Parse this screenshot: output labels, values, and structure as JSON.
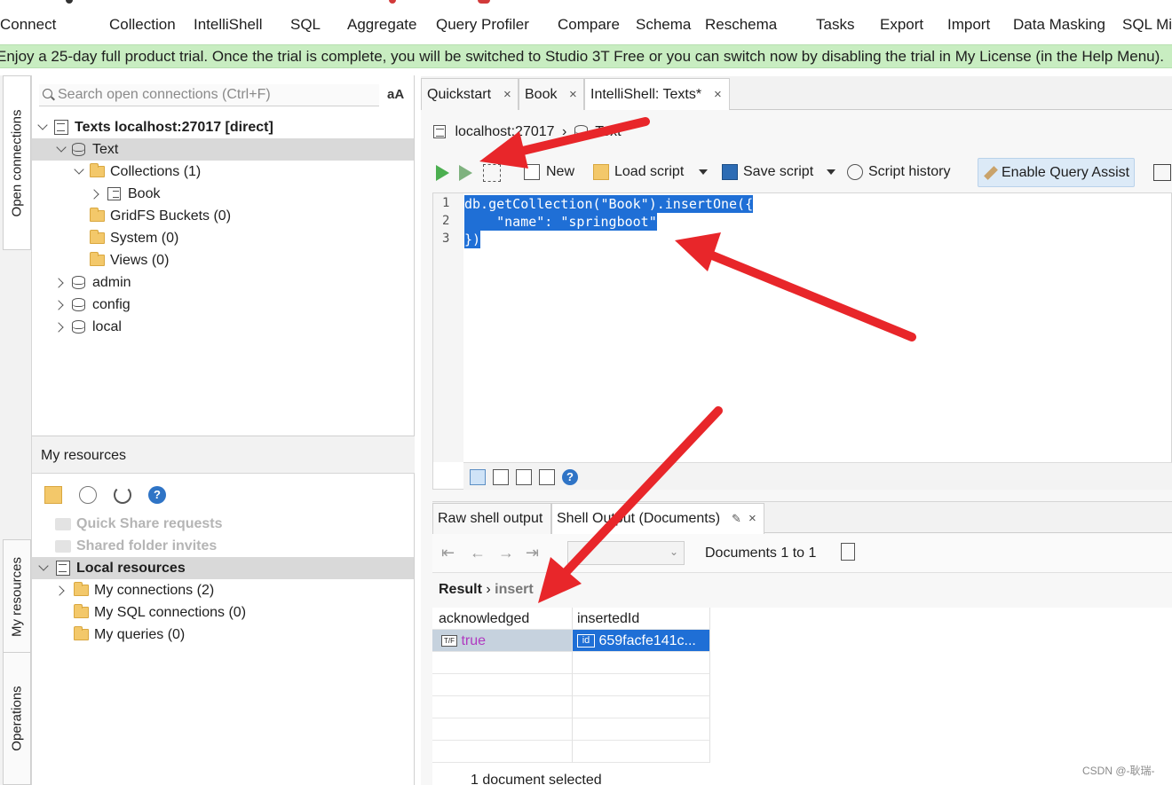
{
  "toolbar": {
    "items": [
      "Connect",
      "Collection",
      "IntelliShell",
      "SQL",
      "Aggregate",
      "Query Profiler",
      "Compare",
      "Schema",
      "Reschema",
      "Tasks",
      "Export",
      "Import",
      "Data Masking",
      "SQL Mig"
    ]
  },
  "banner": {
    "text": "Enjoy a 25-day full product trial. Once the trial is complete, you will be switched to Studio 3T Free or you can switch now by disabling the trial in My License (in the Help Menu)."
  },
  "side_tabs": [
    "Open connections",
    "My resources",
    "Operations"
  ],
  "connections": {
    "search_placeholder": "Search open connections (Ctrl+F)",
    "font_toggle": "aA",
    "tree": {
      "server": "Texts localhost:27017 [direct]",
      "db_selected": "Text",
      "collections": "Collections (1)",
      "collection_book": "Book",
      "gridfs": "GridFS Buckets (0)",
      "system": "System (0)",
      "views": "Views (0)",
      "db_admin": "admin",
      "db_config": "config",
      "db_local": "local"
    }
  },
  "my_resources": {
    "title": "My resources",
    "quick_share": "Quick Share requests",
    "shared_invites": "Shared folder invites",
    "local_resources": "Local resources",
    "my_connections": "My connections (2)",
    "my_sql_connections": "My SQL connections (0)",
    "my_queries": "My queries (0)"
  },
  "editor": {
    "tabs": [
      {
        "label": "Quickstart",
        "close": "×"
      },
      {
        "label": "Book",
        "close": "×"
      },
      {
        "label": "IntelliShell: Texts*",
        "close": "×"
      }
    ],
    "breadcrumb_host": "localhost:27017",
    "breadcrumb_db": "Text",
    "toolbar": {
      "new": "New",
      "load_script": "Load script",
      "save_script": "Save script",
      "script_history": "Script history",
      "query_assist": "Enable Query Assist"
    },
    "line_numbers": [
      "1",
      "2",
      "3"
    ],
    "code_lines": [
      "db.getCollection(\"Book\").insertOne({",
      "    \"name\": \"springboot\"",
      "})"
    ]
  },
  "results": {
    "tabs": [
      {
        "label": "Raw shell output"
      },
      {
        "label": "Shell Output (Documents)",
        "close": "×"
      }
    ],
    "documents_label": "Documents 1 to 1",
    "path_root": "Result",
    "path_child": "insert",
    "columns": [
      "acknowledged",
      "insertedId"
    ],
    "row": {
      "acknowledged": "true",
      "insertedId": "659facfe141c...",
      "id_badge": "id",
      "bool_badge": "T/F"
    },
    "status": "1 document selected"
  },
  "watermark": "CSDN @-耿瑞-",
  "colors": {
    "banner": "#c8edc1",
    "selection": "#1f6fd6",
    "run_green": "#4caf50",
    "annotation_arrow": "#e8262a"
  }
}
